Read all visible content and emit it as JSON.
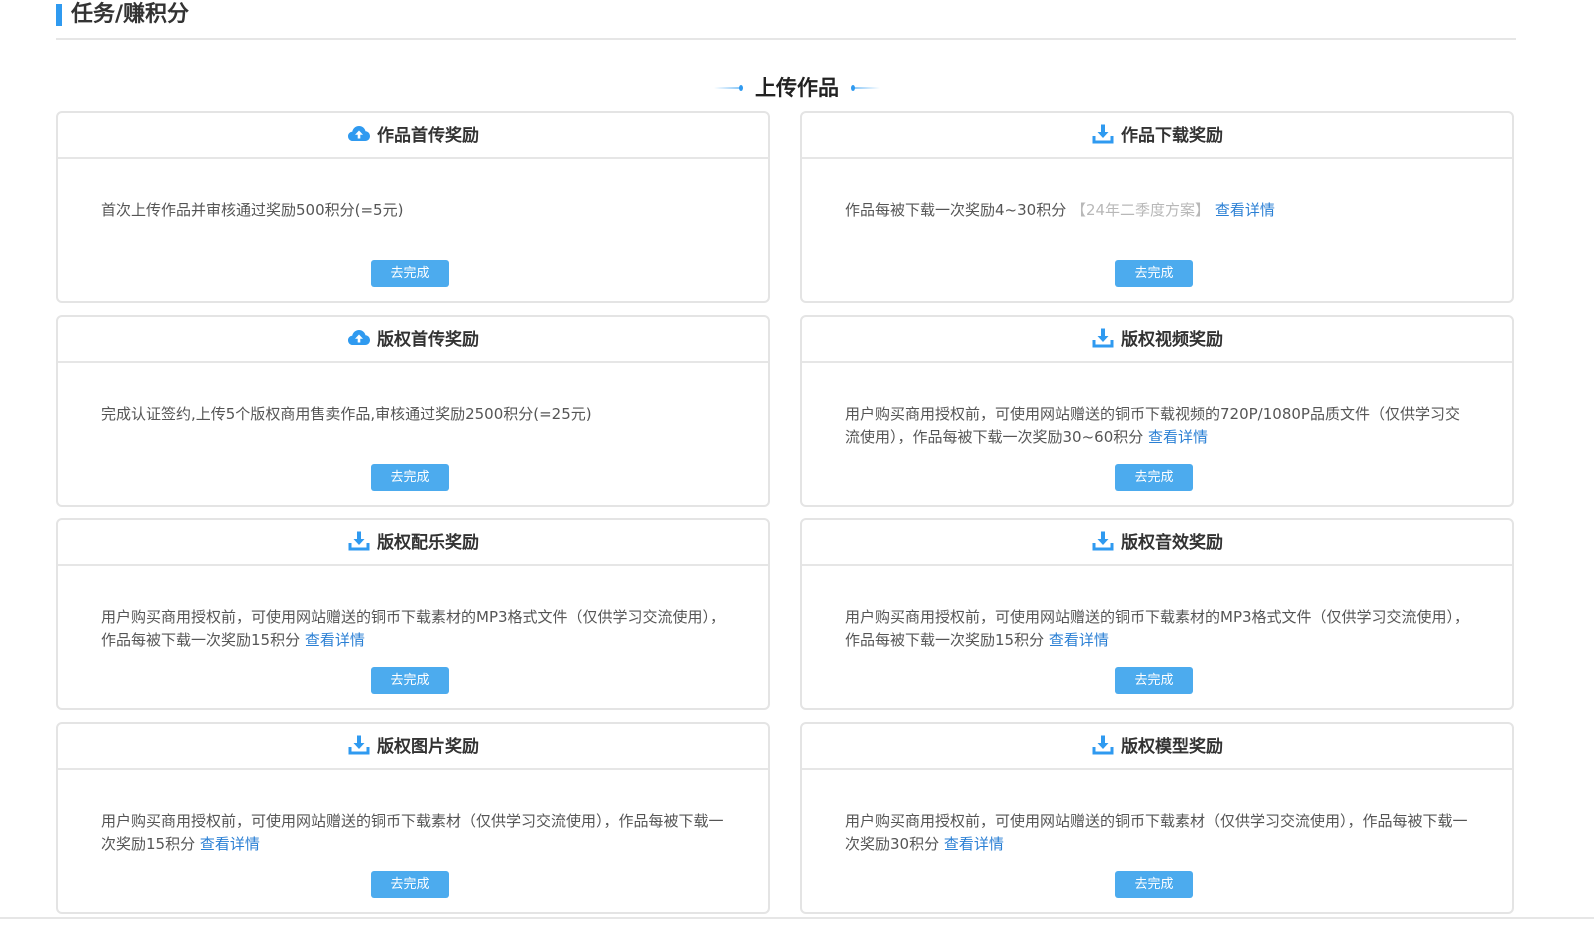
{
  "header": {
    "title": "任务/赚积分"
  },
  "section": {
    "title": "上传作品"
  },
  "colors": {
    "accent": "#2f9af0",
    "button": "#4cabee",
    "link": "#2a7fd4"
  },
  "cards": [
    {
      "icon": "cloud-upload-icon",
      "title": "作品首传奖励",
      "desc": "首次上传作品并审核通过奖励500积分(=5元)",
      "muted": "",
      "link": "",
      "button": "去完成"
    },
    {
      "icon": "download-icon",
      "title": "作品下载奖励",
      "desc": "作品每被下载一次奖励4~30积分 ",
      "muted": "【24年二季度方案】",
      "link": " 查看详情",
      "button": "去完成"
    },
    {
      "icon": "cloud-upload-icon",
      "title": "版权首传奖励",
      "desc": "完成认证签约,上传5个版权商用售卖作品,审核通过奖励2500积分(=25元)",
      "muted": "",
      "link": "",
      "button": "去完成"
    },
    {
      "icon": "download-icon",
      "title": "版权视频奖励",
      "desc": "用户购买商用授权前，可使用网站赠送的铜币下载视频的720P/1080P品质文件（仅供学习交流使用），作品每被下载一次奖励30~60积分 ",
      "muted": "",
      "link": "查看详情",
      "button": "去完成"
    },
    {
      "icon": "download-icon",
      "title": "版权配乐奖励",
      "desc": "用户购买商用授权前，可使用网站赠送的铜币下载素材的MP3格式文件（仅供学习交流使用），作品每被下载一次奖励15积分 ",
      "muted": "",
      "link": "查看详情",
      "button": "去完成"
    },
    {
      "icon": "download-icon",
      "title": "版权音效奖励",
      "desc": "用户购买商用授权前，可使用网站赠送的铜币下载素材的MP3格式文件（仅供学习交流使用），作品每被下载一次奖励15积分 ",
      "muted": "",
      "link": "查看详情",
      "button": "去完成"
    },
    {
      "icon": "download-icon",
      "title": "版权图片奖励",
      "desc": "用户购买商用授权前，可使用网站赠送的铜币下载素材（仅供学习交流使用），作品每被下载一次奖励15积分 ",
      "muted": "",
      "link": "查看详情",
      "button": "去完成"
    },
    {
      "icon": "download-icon",
      "title": "版权模型奖励",
      "desc": "用户购买商用授权前，可使用网站赠送的铜币下载素材（仅供学习交流使用），作品每被下载一次奖励30积分 ",
      "muted": "",
      "link": "查看详情",
      "button": "去完成"
    }
  ]
}
